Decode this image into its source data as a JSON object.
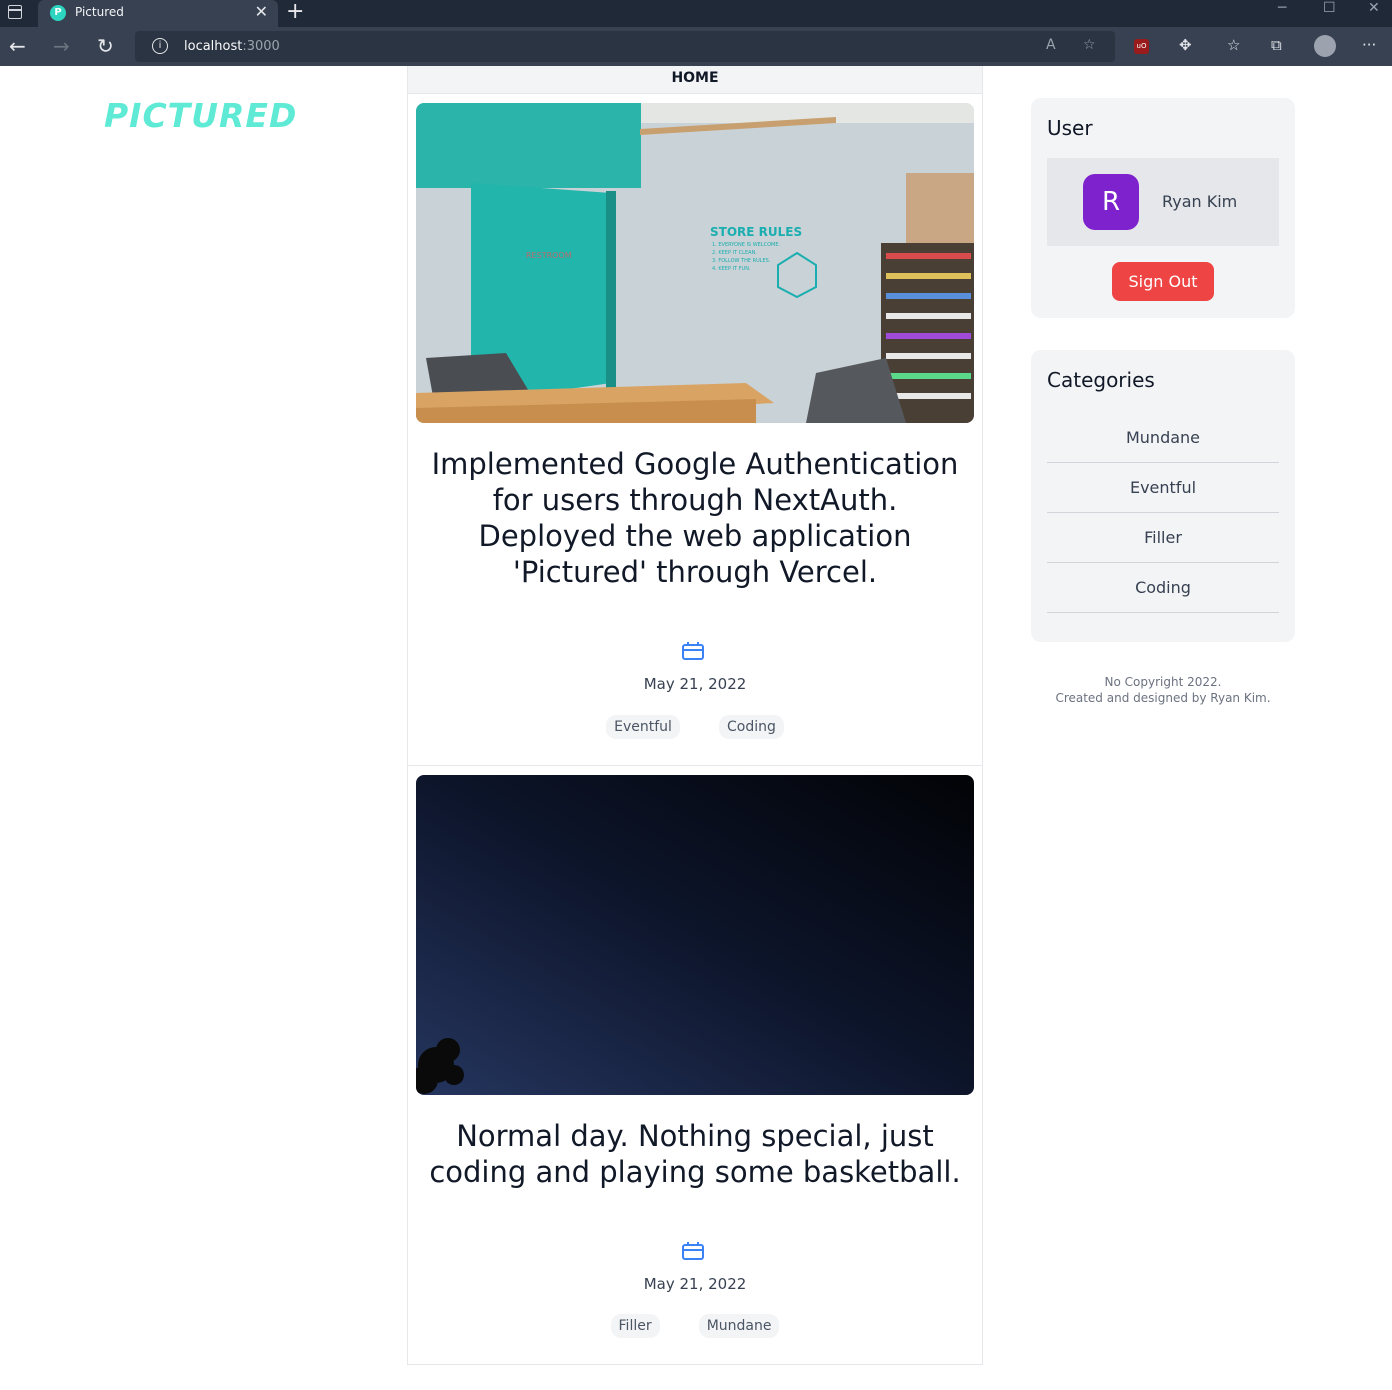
{
  "browser": {
    "tab_title": "Pictured",
    "tab_favicon_letter": "P",
    "new_tab_label": "+",
    "close_tab_label": "✕",
    "url_host": "localhost",
    "url_port": ":3000"
  },
  "header": {
    "logo": "PICTURED",
    "nav_label": "HOME"
  },
  "posts": [
    {
      "title": "Implemented Google Authentication for users through NextAuth. Deployed the web application 'Pictured' through Vercel.",
      "date": "May 21, 2022",
      "tags": [
        "Eventful",
        "Coding"
      ]
    },
    {
      "title": "Normal day. Nothing special, just coding and playing some basketball.",
      "date": "May 21, 2022",
      "tags": [
        "Filler",
        "Mundane"
      ]
    }
  ],
  "user_card": {
    "title": "User",
    "avatar_letter": "R",
    "name": "Ryan Kim",
    "sign_out_label": "Sign Out"
  },
  "categories_card": {
    "title": "Categories",
    "items": [
      "Mundane",
      "Eventful",
      "Filler",
      "Coding"
    ]
  },
  "footer": {
    "line1": "No Copyright 2022.",
    "line2": "Created and designed by Ryan Kim."
  },
  "colors": {
    "logo": "#5eead4",
    "avatar": "#7e22ce",
    "sign_out": "#ef4444",
    "calendar_icon": "#3b82f6"
  }
}
